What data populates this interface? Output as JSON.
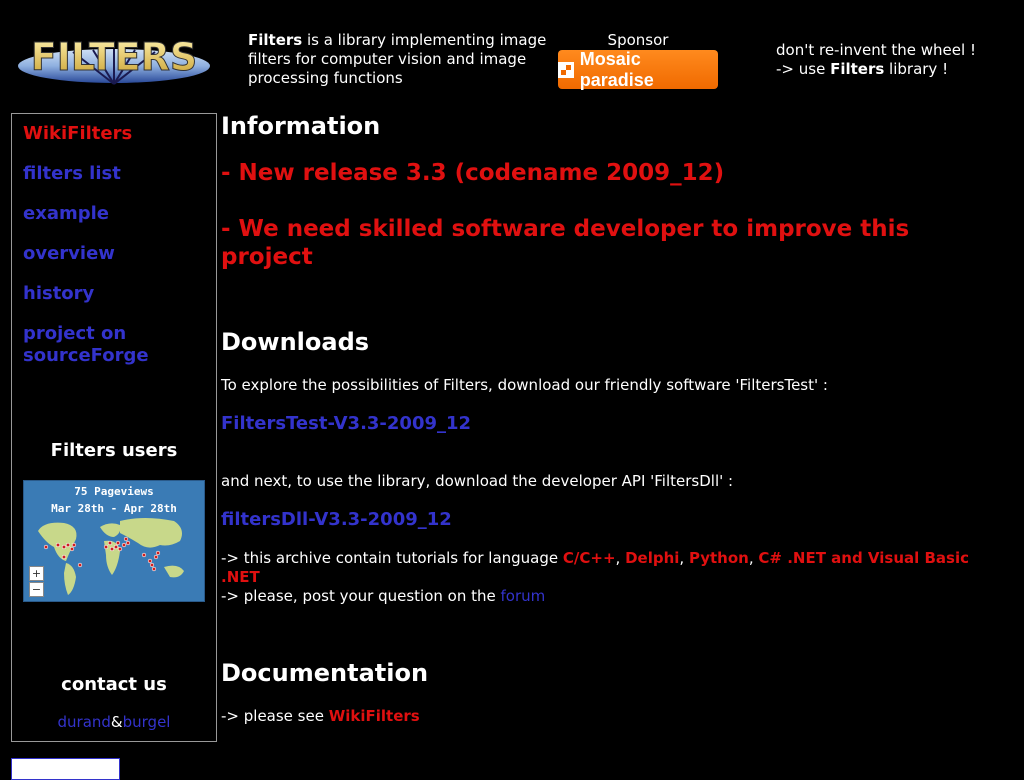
{
  "header": {
    "logo_text": "FILTERS",
    "tagline_bold": "Filters",
    "tagline_rest": " is a library implementing image filters for computer vision and image processing functions",
    "sponsor_label": "Sponsor",
    "sponsor_button": "Mosaic paradise",
    "wheel_line1": "don't re-invent the wheel !",
    "wheel_line2_prefix": "-> use ",
    "wheel_line2_bold": "Filters",
    "wheel_line2_suffix": " library !"
  },
  "sidebar": {
    "items": [
      {
        "label": "WikiFilters"
      },
      {
        "label": "filters list"
      },
      {
        "label": "example"
      },
      {
        "label": "overview"
      },
      {
        "label": "history"
      },
      {
        "label": "project on sourceForge"
      }
    ],
    "users_heading": "Filters users",
    "map_line1": "75 Pageviews",
    "map_line2": "Mar 28th - Apr 28th",
    "zoom_in": "+",
    "zoom_out": "−",
    "contact_heading": "contact us",
    "contact_name1": "durand",
    "contact_amp": "&",
    "contact_name2": "burgel"
  },
  "main": {
    "info_heading": "Information",
    "news1": "- New release 3.3 (codename 2009_12)",
    "news2": "- We need skilled software developer to improve this project",
    "downloads_heading": "Downloads",
    "explore_text": "To explore the possibilities of Filters, download our friendly software 'FiltersTest' :",
    "filterstest_link": "FiltersTest-V3.3-2009_12",
    "next_text": "and next, to use the library, download the developer API 'FiltersDll' :",
    "filtersdll_link": "filtersDll-V3.3-2009_12",
    "archive_prefix": "-> this archive contain tutorials for language ",
    "lang_c": "C/C++",
    "sep1": ", ",
    "lang_delphi": "Delphi",
    "sep2": ", ",
    "lang_python": "Python",
    "sep3": ", ",
    "lang_net": "C# .NET and Visual Basic .NET",
    "forum_prefix": "-> please, post your question on the ",
    "forum_link": "forum",
    "doc_heading": "Documentation",
    "doc_prefix": "-> please see ",
    "doc_link": "WikiFilters"
  },
  "colors": {
    "link_blue": "#3333cc",
    "accent_red": "#e01010",
    "sponsor_orange": "#f06a00",
    "background": "#000000"
  }
}
